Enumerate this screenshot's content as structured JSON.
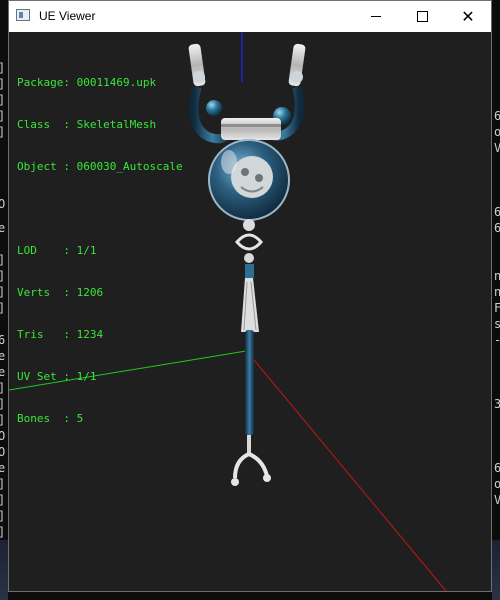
{
  "window": {
    "title": "UE Viewer",
    "minimize_label": "",
    "maximize_label": "",
    "close_label": "✕"
  },
  "info": {
    "package_label": "Package: ",
    "package_value": "00011469.upk",
    "class_label": "Class  : ",
    "class_value": "SkeletalMesh",
    "object_label": "Object : ",
    "object_value": "060030_Autoscale",
    "lod_label": "LOD    : ",
    "lod_value": "1/1",
    "verts_label": "Verts  : ",
    "verts_value": "1206",
    "tris_label": "Tris   : ",
    "tris_value": "1234",
    "uvset_label": "UV Set : ",
    "uvset_value": "1/1",
    "bones_label": "Bones  : ",
    "bones_value": "5"
  },
  "background_console": {
    "left_glyphs": [
      "]",
      "]",
      "]",
      "]",
      "]",
      "O",
      "e",
      "]",
      "]",
      "]",
      "]",
      "6",
      "e",
      "e",
      "]",
      "]",
      "]",
      "O",
      "O",
      "e",
      "]",
      "]",
      "]",
      "]",
      "O",
      "e",
      "]"
    ],
    "right_glyphs": [
      "6",
      "o",
      "V",
      "6",
      "6",
      "n",
      "n",
      "F",
      "s",
      "-",
      "3",
      "6",
      "o",
      "V"
    ]
  },
  "colors": {
    "info_text": "#39e639",
    "axis_x": "#c01818",
    "axis_y": "#22c722",
    "axis_z": "#2020d0",
    "viewport_bg": "#1f1f1f"
  }
}
